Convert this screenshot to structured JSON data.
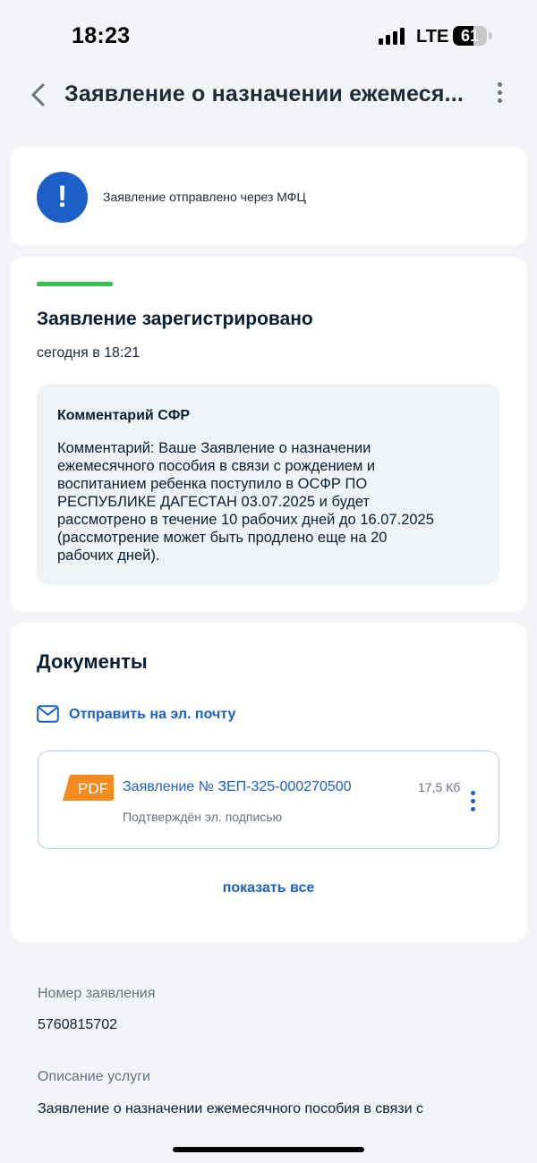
{
  "status_bar": {
    "time": "18:23",
    "network": "LTE",
    "battery": "61",
    "battery_level": 0.61
  },
  "header": {
    "title": "Заявление о назначении ежемеся...",
    "back_icon": "chevron-left-icon",
    "menu_icon": "more-vertical-icon"
  },
  "notice": {
    "icon": "exclamation-icon",
    "text": "Заявление отправлено через МФЦ",
    "accent_color": "#1c5fc8"
  },
  "status": {
    "title": "Заявление зарегистрировано",
    "date": "сегодня в 18:21",
    "progress_color": "#33c34b",
    "comment_title": "Комментарий СФР",
    "comment_lines": [
      "Комментарий: Ваше Заявление о назначении",
      "ежемесячного пособия в связи с рождением и",
      "воспитанием ребенка поступило в ОСФР ПО",
      "РЕСПУБЛИКЕ ДАГЕСТАН 03.07.2025 и будет",
      "рассмотрено в течение 10 рабочих дней до 16.07.2025",
      "(рассмотрение может быть продлено еще на 20",
      "рабочих дней)."
    ]
  },
  "documents": {
    "title": "Документы",
    "email_label": "Отправить на эл. почту",
    "email_icon": "mail-icon",
    "items": [
      {
        "badge": "PDF",
        "name": "Заявление № ЗЕП-325-000270500",
        "size": "17,5 Кб",
        "signature": "Подтверждён эл. подписью"
      }
    ],
    "show_all": "показать все"
  },
  "details": {
    "number_label": "Номер заявления",
    "number_value": "5760815702",
    "service_label": "Описание услуги",
    "service_value": "Заявление о назначении ежемесячного пособия в связи с"
  }
}
